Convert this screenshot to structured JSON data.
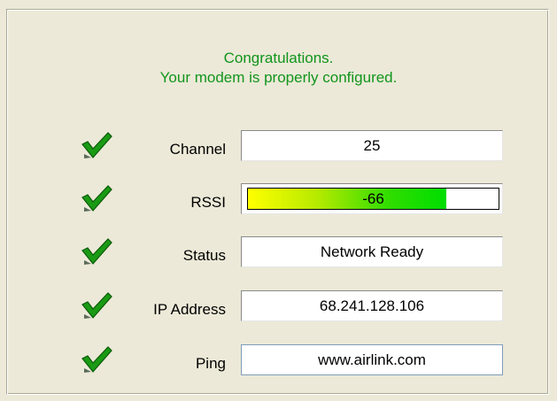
{
  "message": {
    "line1": "Congratulations.",
    "line2": "Your modem is properly configured."
  },
  "rows": [
    {
      "label": "Channel",
      "value": "25",
      "icon": "checkmark-icon",
      "status": "ok"
    },
    {
      "label": "RSSI",
      "value": "-66",
      "icon": "checkmark-icon",
      "status": "ok"
    },
    {
      "label": "Status",
      "value": "Network Ready",
      "icon": "checkmark-icon",
      "status": "ok"
    },
    {
      "label": "IP Address",
      "value": "68.241.128.106",
      "icon": "checkmark-icon",
      "status": "ok"
    },
    {
      "label": "Ping",
      "value": "www.airlink.com",
      "icon": "checkmark-icon",
      "status": "ok"
    }
  ],
  "rssi_level": 0.79,
  "colors": {
    "message": "#12951c",
    "check": "#1a9a14",
    "background": "#ece9d8"
  }
}
